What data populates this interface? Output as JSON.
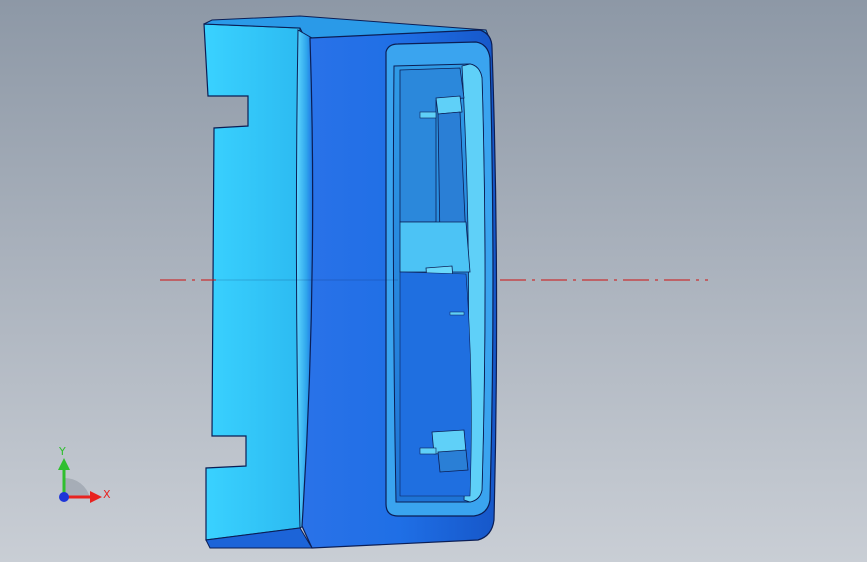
{
  "viewport": {
    "background_top": "#8d98a6",
    "background_bottom": "#c9ced5"
  },
  "model": {
    "side_face_color": "#33ccff",
    "front_face_color": "#1f6fe6",
    "cavity_color": "#2a8fe0",
    "inner_wall_color": "#4cc3f5",
    "edge_color": "#0b1e55"
  },
  "centerline": {
    "color": "#d01010"
  },
  "triad": {
    "x_label": "X",
    "y_label": "Y",
    "x_color": "#e8231f",
    "y_color": "#2fbf2f",
    "z_color": "#1d35d8"
  }
}
